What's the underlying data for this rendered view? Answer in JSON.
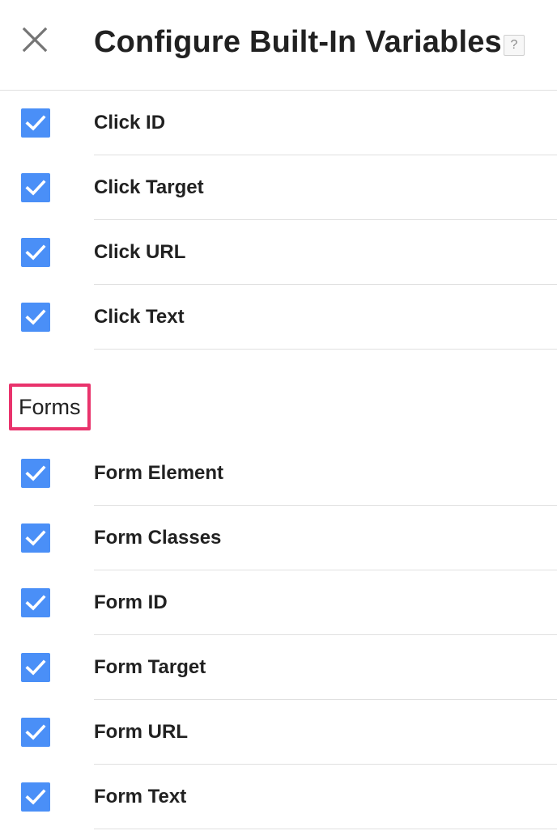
{
  "header": {
    "title": "Configure Built-In Variables",
    "close_icon": "close-icon",
    "help_label": "?"
  },
  "clicks": {
    "items": [
      {
        "label": "Click ID",
        "checked": true
      },
      {
        "label": "Click Target",
        "checked": true
      },
      {
        "label": "Click URL",
        "checked": true
      },
      {
        "label": "Click Text",
        "checked": true
      }
    ]
  },
  "forms": {
    "heading": "Forms",
    "heading_highlight_color": "#e9336c",
    "items": [
      {
        "label": "Form Element",
        "checked": true
      },
      {
        "label": "Form Classes",
        "checked": true
      },
      {
        "label": "Form ID",
        "checked": true
      },
      {
        "label": "Form Target",
        "checked": true
      },
      {
        "label": "Form URL",
        "checked": true
      },
      {
        "label": "Form Text",
        "checked": true
      }
    ]
  },
  "colors": {
    "checkbox": "#4a8ff7",
    "divider": "#e0e0e0",
    "text": "#212121"
  }
}
